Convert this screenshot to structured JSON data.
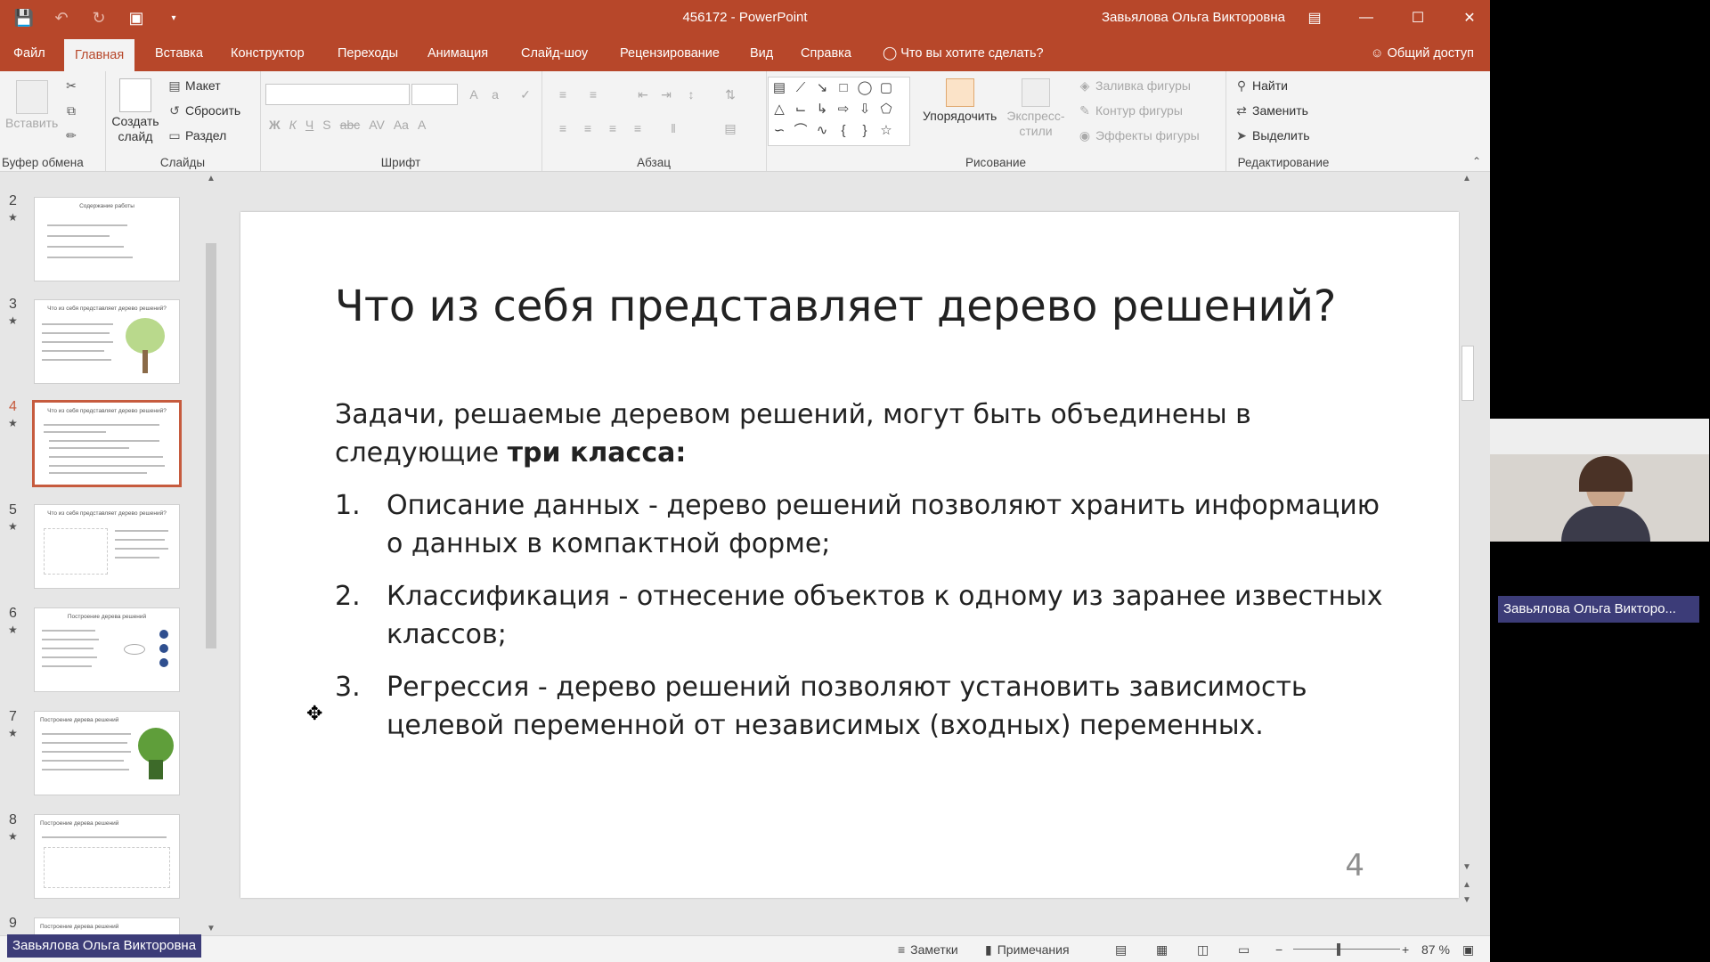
{
  "window": {
    "title": "456172 - PowerPoint",
    "user": "Завьялова Ольга Викторовна"
  },
  "tabs": [
    "Файл",
    "Главная",
    "Вставка",
    "Конструктор",
    "Переходы",
    "Анимация",
    "Слайд-шоу",
    "Рецензирование",
    "Вид",
    "Справка"
  ],
  "active_tab": "Главная",
  "tell_me": "Что вы хотите сделать?",
  "share": "Общий доступ",
  "ribbon": {
    "clipboard": {
      "paste": "Вставить",
      "label": "Буфер обмена"
    },
    "slides": {
      "new_slide": "Создать слайд",
      "layout": "Макет",
      "reset": "Сбросить",
      "section": "Раздел",
      "label": "Слайды"
    },
    "font": {
      "label": "Шрифт",
      "buttons": [
        "Ж",
        "К",
        "Ч",
        "S",
        "abc",
        "AV",
        "Aa",
        "A"
      ]
    },
    "paragraph": {
      "label": "Абзац"
    },
    "drawing": {
      "arrange": "Упорядочить",
      "quick_styles": "Экспресс-стили",
      "fill": "Заливка фигуры",
      "outline": "Контур фигуры",
      "effects": "Эффекты фигуры",
      "label": "Рисование"
    },
    "editing": {
      "find": "Найти",
      "replace": "Заменить",
      "select": "Выделить",
      "label": "Редактирование"
    }
  },
  "thumbnails": [
    {
      "num": "2",
      "title": "Содержание работы"
    },
    {
      "num": "3",
      "title": "Что из себя представляет дерево решений?"
    },
    {
      "num": "4",
      "title": "Что из себя представляет дерево решений?"
    },
    {
      "num": "5",
      "title": "Что из себя представляет дерево решений?"
    },
    {
      "num": "6",
      "title": "Построение дерева решений"
    },
    {
      "num": "7",
      "title": "Построение дерева решений"
    },
    {
      "num": "8",
      "title": "Построение дерева решений"
    },
    {
      "num": "9",
      "title": "Построение дерева решений"
    }
  ],
  "slide": {
    "title": "Что из себя представляет дерево решений?",
    "intro": "Задачи, решаемые деревом решений, могут быть объединены в следующие",
    "intro_bold": "три класса:",
    "items": [
      {
        "num": "1.",
        "text": "Описание данных - дерево решений позволяют хранить информацию о данных в компактной форме;"
      },
      {
        "num": "2.",
        "text": "Классификация - отнесение объектов к одному из заранее известных классов;"
      },
      {
        "num": "3.",
        "text": "Регрессия - дерево решений позволяют установить зависимость целевой переменной от независимых (входных) переменных."
      }
    ],
    "number": "4"
  },
  "status": {
    "notes": "Заметки",
    "comments": "Примечания",
    "zoom": "87 %"
  },
  "video_participant": "Завьялова Ольга Викторо..."
}
